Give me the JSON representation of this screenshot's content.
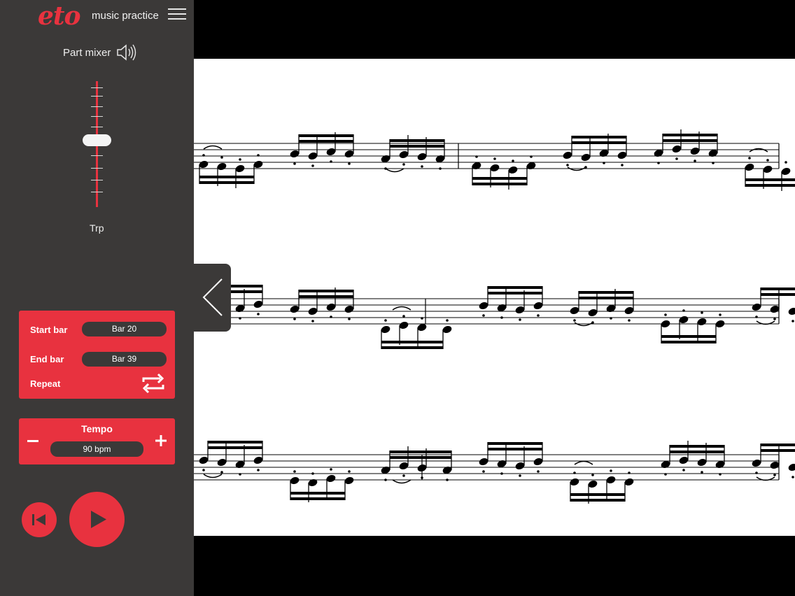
{
  "app": {
    "logo": "eto",
    "subtitle": "music practice"
  },
  "mixer": {
    "title": "Part mixer",
    "part": "Trp",
    "volume_level": 0.53
  },
  "range": {
    "start_label": "Start bar",
    "start_value": "Bar 20",
    "end_label": "End bar",
    "end_value": "Bar 39",
    "repeat_label": "Repeat"
  },
  "tempo": {
    "title": "Tempo",
    "value": "90 bpm"
  },
  "icons": {
    "menu": "hamburger-icon",
    "speaker": "speaker-icon",
    "repeat": "repeat-icon",
    "minus": "minus-icon",
    "plus": "plus-icon",
    "rewind": "skip-back-icon",
    "play": "play-icon",
    "collapse": "chevron-left-icon"
  },
  "colors": {
    "accent": "#e8323f",
    "sidebar": "#3b3938",
    "background": "#000000",
    "score": "#ffffff"
  }
}
